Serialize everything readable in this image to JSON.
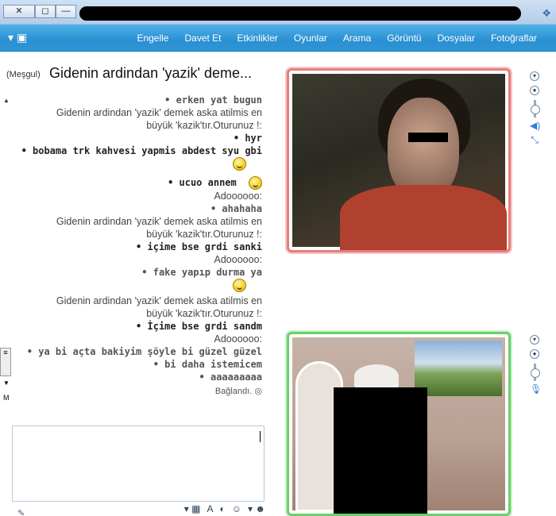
{
  "window": {
    "buttons": [
      "✕",
      "◻",
      "—"
    ]
  },
  "menu": {
    "items": [
      "Engelle",
      "Davet Et",
      "Etkinlikler",
      "Oyunlar",
      "Arama",
      "Görüntü",
      "Dosyalar",
      "Fotoğraflar"
    ]
  },
  "conversation": {
    "title": "Gidenin ardindan 'yazik' deme...",
    "status": "(Meşgul)"
  },
  "chat": {
    "messages": [
      "• erken yat bugun",
      "Gidenin ardindan 'yazik' demek aska atilmis en",
      "büyük 'kazik'tır.Oturunuz !:",
      "• hyr",
      "• bobama trk kahvesi yapmis abdest syu gbi",
      "• ucuo annem",
      "Adoooooo:",
      "• ahahaha",
      "Gidenin ardindan 'yazik' demek aska atilmis en",
      "büyük 'kazik'tır.Oturunuz !:",
      "• içime bse grdi sanki",
      "Adoooooo:",
      "• fake yapıp durma ya",
      "Gidenin ardindan 'yazik' demek aska atilmis en",
      "büyük 'kazik'tır.Oturunuz !:",
      "• İçime bse grdi sandm",
      "Adoooooo:",
      "• ya bi açta bakiyim şöyle bi güzel güzel",
      "• bi daha istemicem",
      "• aaaaaaaaa"
    ],
    "connection_status": "Bağlandı."
  },
  "input": {
    "value": ""
  },
  "toolbar": {
    "font_label": "A"
  },
  "icons": {
    "title_icon": "messenger-icon",
    "tools": "tools-icon",
    "emoticon": "smiley-icon"
  },
  "colors": {
    "menu_bar": "#2a8fd2",
    "cam_busy_border": "#e87c7c",
    "cam_self_border": "#6ad06a"
  }
}
